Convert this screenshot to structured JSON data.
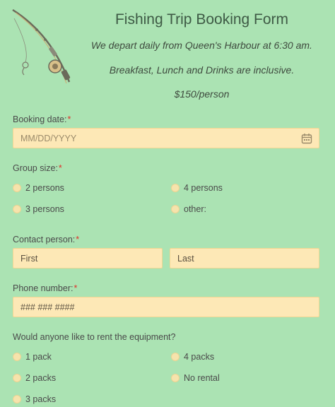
{
  "header": {
    "title": "Fishing Trip Booking Form",
    "tagline1": "We depart daily from Queen's Harbour at 6:30 am.",
    "tagline2": "Breakfast, Lunch and Drinks are inclusive.",
    "price": "$150/person"
  },
  "booking_date": {
    "label": "Booking date:",
    "required": "*",
    "placeholder": "MM/DD/YYYY",
    "icon": "calendar-icon"
  },
  "group_size": {
    "label": "Group size:",
    "required": "*",
    "options": [
      "2 persons",
      "4 persons",
      "3 persons",
      "other:"
    ]
  },
  "contact": {
    "label": "Contact person:",
    "required": "*",
    "first_placeholder": "First",
    "last_placeholder": "Last"
  },
  "phone": {
    "label": "Phone number:",
    "required": "*",
    "placeholder": "### ### ####"
  },
  "equipment": {
    "label": "Would anyone like to rent the equipment?",
    "options": [
      "1 pack",
      "4 packs",
      "2 packs",
      "No rental",
      "3 packs"
    ]
  },
  "colors": {
    "background": "#abe3b3",
    "field": "#fde8b6",
    "required": "#e0312b"
  }
}
